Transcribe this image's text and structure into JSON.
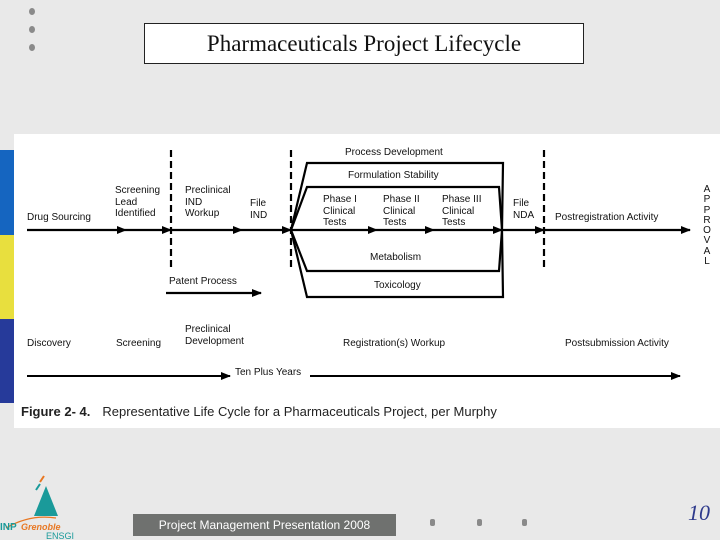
{
  "slide": {
    "title": "Pharmaceuticals Project Lifecycle",
    "page_number": "10",
    "footer_text": "Project Management  Presentation 2008",
    "logo": {
      "name": "INP Grenoble ENSGI",
      "line1_a": "INP",
      "line1_b": "Grenoble",
      "line2": "ENSGI"
    },
    "colors": {
      "bar_blue": "#1565c0",
      "bar_yellow": "#e8df3e",
      "bar_navy": "#263a9a",
      "footer_bg": "#6f716f",
      "page_number": "#2e3a8c",
      "logo_teal": "#1a9a9a",
      "logo_orange": "#e87722"
    }
  },
  "figure": {
    "top_labels": {
      "process_development": "Process Development",
      "formulation_stability": "Formulation Stability",
      "metabolism": "Metabolism",
      "toxicology": "Toxicology",
      "patent_process": "Patent Process"
    },
    "main_flow": [
      {
        "id": "drug-sourcing",
        "label": "Drug Sourcing"
      },
      {
        "id": "screening-lead",
        "label": "Screening\nLead\nIdentified"
      },
      {
        "id": "preclinical-ind",
        "label": "Preclinical\nIND\nWorkup"
      },
      {
        "id": "file-ind",
        "label": "File\nIND"
      },
      {
        "id": "phase-1",
        "label": "Phase I\nClinical\nTests"
      },
      {
        "id": "phase-2",
        "label": "Phase II\nClinical\nTests"
      },
      {
        "id": "phase-3",
        "label": "Phase III\nClinical\nTests"
      },
      {
        "id": "file-nda",
        "label": "File\nNDA"
      },
      {
        "id": "postregistration",
        "label": "Postregistration Activity"
      }
    ],
    "approval": "APPROVAL",
    "stages": [
      {
        "id": "discovery",
        "label": "Discovery"
      },
      {
        "id": "screening",
        "label": "Screening"
      },
      {
        "id": "preclinical-dev",
        "label": "Preclinical\nDevelopment"
      },
      {
        "id": "registration",
        "label": "Registration(s) Workup"
      },
      {
        "id": "postsubmission",
        "label": "Postsubmission Activity"
      }
    ],
    "timeline_label": "Ten Plus Years",
    "caption_number": "Figure 2- 4.",
    "caption_text": "Representative Life Cycle for a Pharmaceuticals Project, per Murphy"
  }
}
